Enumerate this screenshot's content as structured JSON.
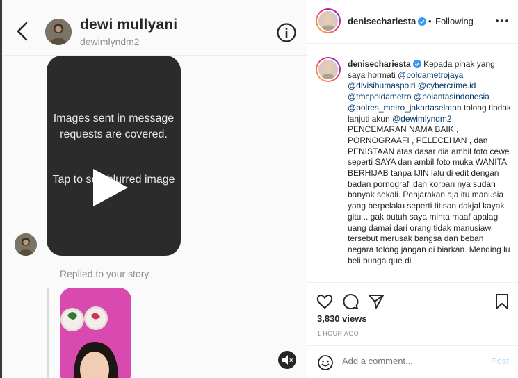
{
  "dm": {
    "name": "dewi mullyani",
    "handle": "dewimlyndm2",
    "media_notice_1": "Images sent in message requests are covered.",
    "media_notice_2": "Tap to see blurred image",
    "replied_label": "Replied to your story"
  },
  "post": {
    "username": "denisechariesta",
    "dot": "•",
    "follow_status": "Following",
    "caption": {
      "p1": "Kepada pihak yang saya hormati",
      "mentions1": "@poldametrojaya @divisihumaspolri @cybercrime.id @tmcpoldametro @polantasindonesia @polres_metro_jakartaselatan",
      "p2": "tolong tindak lanjuti akun",
      "mention2": "@dewimlyndm2",
      "p3": "PENCEMARAN NAMA BAIK , PORNOGRAAFI , PELECEHAN , dan PENISTAAN atas dasar dia ambil foto cewe seperti SAYA dan ambil foto muka WANITA BERHIJAB tanpa IJIN lalu di edit dengan badan pornografi dan korban nya sudah banyak sekali.",
      "p4": "Penjarakan aja itu manusia yang berpelaku seperti titisan dakjal kayak gitu .. gak butuh saya minta maaf apalagi uang damai dari orang tidak manusiawi tersebut merusak bangsa dan beban negara tolong jangan di biarkan. Mending lu beli bunga que di"
    },
    "views": "3,830 views",
    "time_ago": "1 HOUR AGO",
    "comment_placeholder": "Add a comment...",
    "post_label": "Post"
  },
  "colors": {
    "link": "#00376b",
    "verified": "#3897f0",
    "post_disabled": "#b2dffc",
    "media_bg": "#2b2b2b",
    "story_bg": "#d94ab0"
  }
}
